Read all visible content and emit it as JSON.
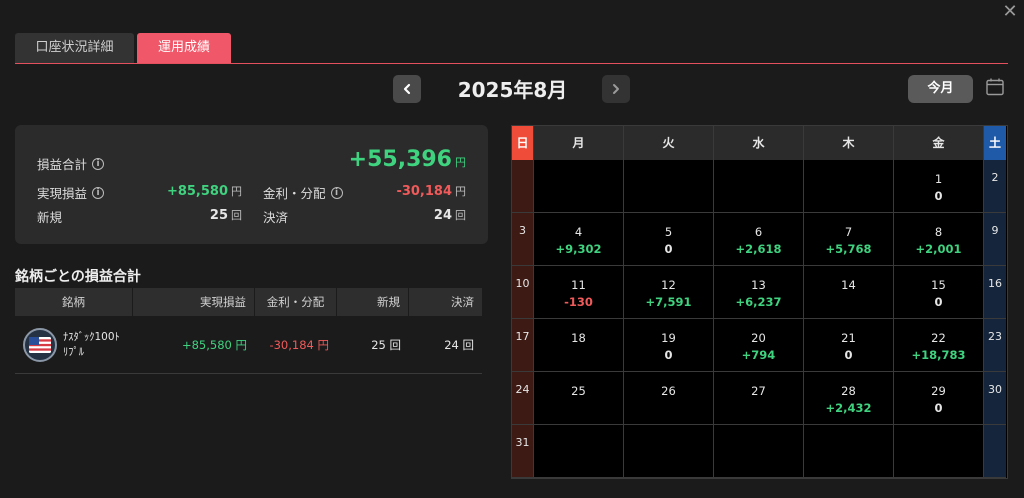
{
  "window": {
    "close_glyph": "✕"
  },
  "tabs": [
    {
      "label": "口座状況詳細",
      "active": false
    },
    {
      "label": "運用成績",
      "active": true
    }
  ],
  "header": {
    "month": "2025年8月",
    "today_label": "今月"
  },
  "summary": {
    "total_label": "損益合計",
    "total_value": "+55,396",
    "realized_label": "実現損益",
    "realized_value": "+85,580",
    "interest_label": "金利・分配",
    "interest_value": "-30,184",
    "new_label": "新規",
    "new_value": "25",
    "settle_label": "決済",
    "settle_value": "24",
    "yen": "円",
    "count_unit": "回"
  },
  "stocks": {
    "title": "銘柄ごとの損益合計",
    "columns": [
      "銘柄",
      "実現損益",
      "金利・分配",
      "新規",
      "決済"
    ],
    "rows": [
      {
        "name_line1": "ﾅｽﾀﾞｯｸ100ﾄ",
        "name_line2": "ﾘﾌﾟﾙ",
        "realized": "+85,580 円",
        "interest": "-30,184 円",
        "new": "25 回",
        "settle": "24 回"
      }
    ]
  },
  "calendar": {
    "weekdays": [
      "日",
      "月",
      "火",
      "水",
      "木",
      "金",
      "土"
    ],
    "weeks": [
      [
        {
          "d": ""
        },
        {
          "d": ""
        },
        {
          "d": ""
        },
        {
          "d": ""
        },
        {
          "d": ""
        },
        {
          "d": "1",
          "v": "0"
        },
        {
          "d": "2"
        }
      ],
      [
        {
          "d": "3"
        },
        {
          "d": "4",
          "v": "+9,302"
        },
        {
          "d": "5",
          "v": "0"
        },
        {
          "d": "6",
          "v": "+2,618"
        },
        {
          "d": "7",
          "v": "+5,768"
        },
        {
          "d": "8",
          "v": "+2,001"
        },
        {
          "d": "9"
        }
      ],
      [
        {
          "d": "10"
        },
        {
          "d": "11",
          "v": "-130"
        },
        {
          "d": "12",
          "v": "+7,591"
        },
        {
          "d": "13",
          "v": "+6,237"
        },
        {
          "d": "14"
        },
        {
          "d": "15",
          "v": "0"
        },
        {
          "d": "16"
        }
      ],
      [
        {
          "d": "17"
        },
        {
          "d": "18"
        },
        {
          "d": "19",
          "v": "0"
        },
        {
          "d": "20",
          "v": "+794"
        },
        {
          "d": "21",
          "v": "0"
        },
        {
          "d": "22",
          "v": "+18,783"
        },
        {
          "d": "23"
        }
      ],
      [
        {
          "d": "24"
        },
        {
          "d": "25"
        },
        {
          "d": "26"
        },
        {
          "d": "27"
        },
        {
          "d": "28",
          "v": "+2,432"
        },
        {
          "d": "29",
          "v": "0"
        },
        {
          "d": "30"
        }
      ],
      [
        {
          "d": "31"
        },
        {
          "d": ""
        },
        {
          "d": ""
        },
        {
          "d": ""
        },
        {
          "d": ""
        },
        {
          "d": ""
        },
        {
          "d": ""
        }
      ]
    ]
  },
  "colors": {
    "positive": "#3fd27f",
    "negative": "#f05a5a",
    "accent": "#f0586a",
    "sunday": "#ef4c3a",
    "saturday": "#1e5aa8"
  }
}
